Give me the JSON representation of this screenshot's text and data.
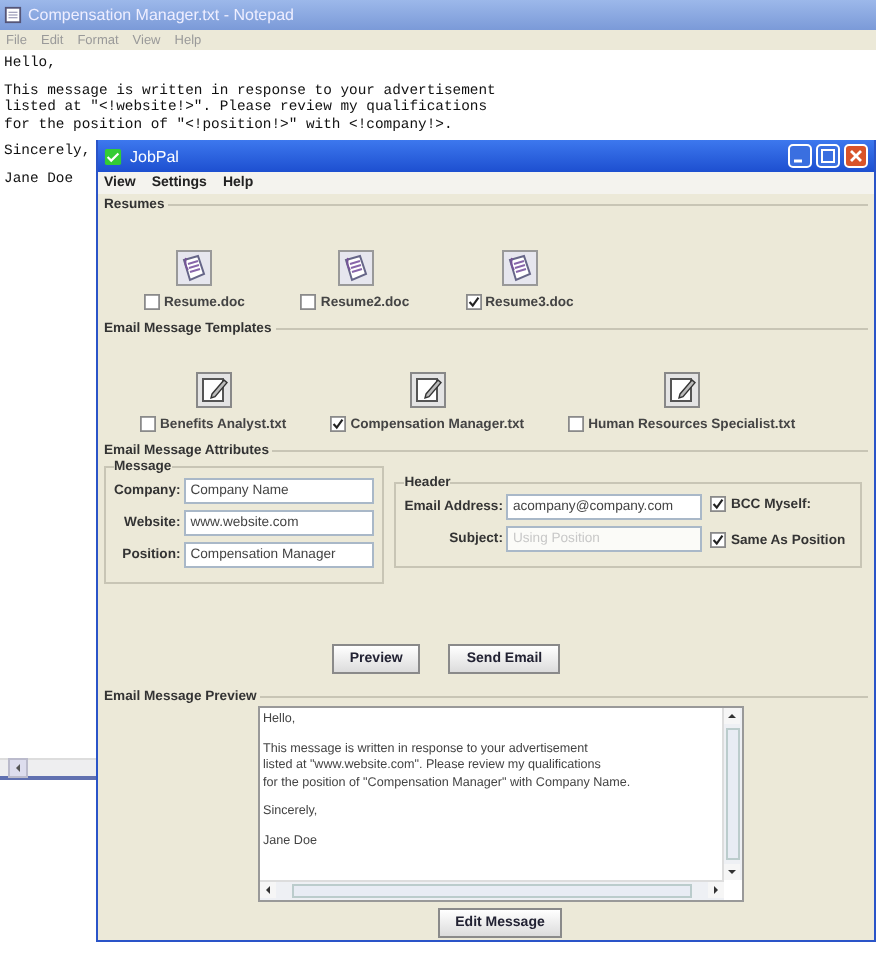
{
  "notepad": {
    "title": "Compensation Manager.txt - Notepad",
    "menu": [
      "File",
      "Edit",
      "Format",
      "View",
      "Help"
    ],
    "paragraphs": [
      [
        "Hello,"
      ],
      [
        "This message is written in response to your advertisement",
        "listed at \"<!website!>\". Please review my qualifications",
        "for the position of \"<!position!>\" with <!company!>."
      ],
      [
        "Sincerely,"
      ],
      [
        "Jane Doe"
      ]
    ]
  },
  "jobpal": {
    "title": "JobPal",
    "menu": [
      "View",
      "Settings",
      "Help"
    ],
    "resumes": {
      "title": "Resumes",
      "items": [
        {
          "label": "Resume.doc",
          "checked": false
        },
        {
          "label": "Resume2.doc",
          "checked": false
        },
        {
          "label": "Resume3.doc",
          "checked": true
        }
      ]
    },
    "templates": {
      "title": "Email Message Templates",
      "items": [
        {
          "label": "Benefits Analyst.txt",
          "checked": false
        },
        {
          "label": "Compensation Manager.txt",
          "checked": true
        },
        {
          "label": "Human Resources Specialist.txt",
          "checked": false
        }
      ]
    },
    "attributes": {
      "title": "Email Message Attributes",
      "message": {
        "title": "Message",
        "fields": [
          {
            "label": "Company:",
            "value": "Company Name"
          },
          {
            "label": "Website:",
            "value": "www.website.com"
          },
          {
            "label": "Position:",
            "value": "Compensation Manager"
          }
        ]
      },
      "header": {
        "title": "Header",
        "fields": [
          {
            "label": "Email Address:",
            "value": "acompany@company.com",
            "disabled": false
          },
          {
            "label": "Subject:",
            "value": "Using Position",
            "disabled": true
          }
        ],
        "options": [
          {
            "label": "BCC Myself:",
            "checked": true
          },
          {
            "label": "Same As Position",
            "checked": true
          }
        ]
      }
    },
    "buttons": [
      "Preview",
      "Send Email"
    ],
    "preview": {
      "title": "Email Message Preview",
      "paragraphs": [
        [
          "Hello,"
        ],
        [
          "This message is written in response to your advertisement",
          "listed at \"www.website.com\". Please review my qualifications",
          "for the position of \"Compensation Manager\" with Company Name."
        ],
        [
          "Sincerely,"
        ],
        [
          "Jane Doe"
        ]
      ],
      "button": "Edit Message"
    }
  }
}
